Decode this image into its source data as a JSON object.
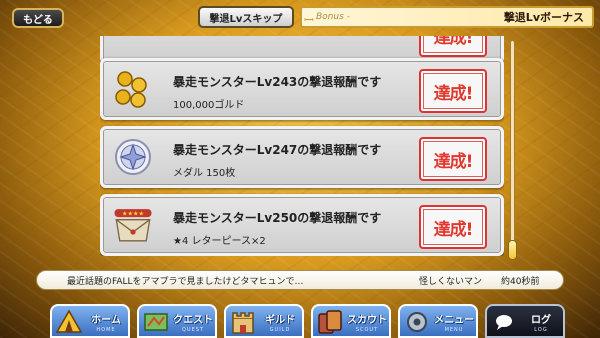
{
  "header": {
    "back_label": "もどる",
    "skip_label": "撃退Lvスキップ",
    "bonus_subtitle": "Bonus -",
    "bonus_title": "撃退Lvボーナス"
  },
  "rewards": [
    {
      "title": "暴走モンスターLv243の撃退報酬です",
      "reward": "100,000ゴルド",
      "icon": "gold-coins-icon",
      "stamp": "達成!"
    },
    {
      "title": "暴走モンスターLv247の撃退報酬です",
      "reward": "メダル 150枚",
      "icon": "medal-icon",
      "stamp": "達成!"
    },
    {
      "title": "暴走モンスターLv250の撃退報酬です",
      "reward": "★4 レターピース×2",
      "icon": "letter-piece-icon",
      "stamp": "達成!"
    }
  ],
  "partial_top_card": {
    "stamp": "達成!"
  },
  "ticker": {
    "message": "最近話題のFALLをアマプラで見ましたけどタマヒュンで…",
    "author": "怪しくないマン",
    "time": "約40秒前"
  },
  "nav": [
    {
      "jp": "ホーム",
      "en": "HOME",
      "icon": "home-tent-icon"
    },
    {
      "jp": "クエスト",
      "en": "QUEST",
      "icon": "quest-map-icon"
    },
    {
      "jp": "ギルド",
      "en": "GUILD",
      "icon": "guild-castle-icon"
    },
    {
      "jp": "スカウト",
      "en": "SCOUT",
      "icon": "scout-cards-icon"
    },
    {
      "jp": "メニュー",
      "en": "MENU",
      "icon": "menu-gear-icon"
    },
    {
      "jp": "ログ",
      "en": "LOG",
      "icon": "log-chat-icon"
    }
  ],
  "colors": {
    "accent_gold": "#d89a1e",
    "stamp_red": "#e0392f",
    "nav_blue": "#3a6fc0"
  }
}
